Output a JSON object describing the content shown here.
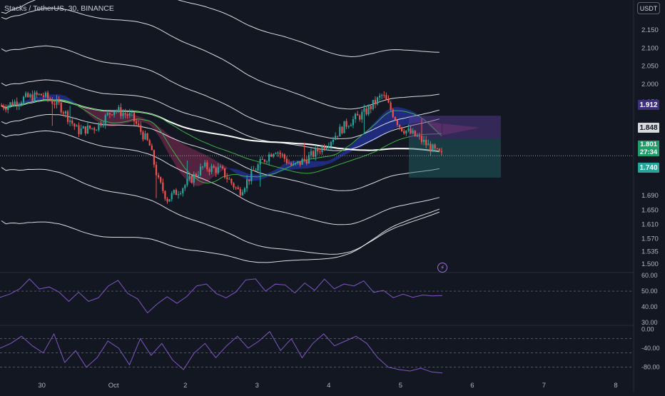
{
  "header": {
    "symbol_title": "Stacks / TetherUS, 30, BINANCE",
    "currency_button": "USDT"
  },
  "price_badges": {
    "upper": "1.912",
    "mid": "1.848",
    "current": "1.801",
    "countdown": "27:34",
    "lower": "1.740"
  },
  "icons": {
    "flash": "lightning-icon"
  },
  "colors": {
    "background": "#131722",
    "bull": "#26a69a",
    "bear": "#ef5350",
    "band": "#ffffff",
    "ma": "#3cb043",
    "oscillator": "#7e57c2",
    "cloud_bull": "#2a3cc8",
    "cloud_bear": "#8a2d5a"
  },
  "chart_data": [
    {
      "type": "candlestick",
      "symbol": "Stacks / TetherUS",
      "interval": "30",
      "exchange": "BINANCE",
      "x_ticks": [
        "30",
        "Oct",
        "2",
        "3",
        "4",
        "5",
        "6",
        "7",
        "8"
      ],
      "y_ticks": [
        2.15,
        2.1,
        2.05,
        2.0,
        1.95,
        1.912,
        1.848,
        1.801,
        1.74,
        1.69,
        1.65,
        1.61,
        1.57,
        1.535,
        1.5
      ],
      "ylim": [
        1.48,
        2.19
      ],
      "close_path": [
        [
          "09-29 12:00",
          1.94
        ],
        [
          "09-29 18:00",
          1.96
        ],
        [
          "09-30 00:00",
          1.97
        ],
        [
          "09-30 06:00",
          1.94
        ],
        [
          "09-30 12:00",
          1.87
        ],
        [
          "09-30 18:00",
          1.88
        ],
        [
          "10-01 00:00",
          1.93
        ],
        [
          "10-01 06:00",
          1.91
        ],
        [
          "10-01 12:00",
          1.83
        ],
        [
          "10-01 15:00",
          1.73
        ],
        [
          "10-01 18:00",
          1.68
        ],
        [
          "10-02 00:00",
          1.72
        ],
        [
          "10-02 06:00",
          1.77
        ],
        [
          "10-02 12:00",
          1.76
        ],
        [
          "10-02 18:00",
          1.7
        ],
        [
          "10-03 00:00",
          1.77
        ],
        [
          "10-03 06:00",
          1.82
        ],
        [
          "10-03 12:00",
          1.77
        ],
        [
          "10-03 18:00",
          1.8
        ],
        [
          "10-04 00:00",
          1.84
        ],
        [
          "10-04 06:00",
          1.89
        ],
        [
          "10-04 12:00",
          1.92
        ],
        [
          "10-04 18:00",
          1.97
        ],
        [
          "10-05 00:00",
          1.88
        ],
        [
          "10-05 06:00",
          1.85
        ],
        [
          "10-05 12:00",
          1.81
        ],
        [
          "10-05 14:00",
          1.8
        ]
      ],
      "position_tool": {
        "entry": 1.848,
        "stop": 1.912,
        "target": 1.74
      },
      "last_price": 1.801,
      "countdown": "27:34"
    },
    {
      "type": "line",
      "title": "",
      "y_ticks": [
        60.0,
        50.0,
        40.0,
        30.0
      ],
      "ylim": [
        29,
        61
      ],
      "levels": [
        50
      ],
      "series": [
        {
          "values": [
            46,
            47,
            53,
            57,
            51,
            54,
            48,
            44,
            50,
            42,
            47,
            53,
            56,
            50,
            44,
            36,
            43,
            45,
            43,
            47,
            52,
            56,
            48,
            45,
            51,
            56,
            58,
            51,
            53,
            55,
            49,
            54,
            52,
            57,
            51,
            56,
            52,
            57,
            50,
            49,
            47,
            48,
            45,
            49,
            46,
            47
          ]
        }
      ]
    },
    {
      "type": "line",
      "title": "",
      "y_ticks": [
        0.0,
        -40.0,
        -80.0
      ],
      "ylim": [
        -100,
        5
      ],
      "levels": [
        -20,
        -50,
        -80
      ],
      "series": [
        {
          "values": [
            -40,
            -30,
            -15,
            -35,
            -50,
            -10,
            -70,
            -45,
            -80,
            -60,
            -25,
            -40,
            -75,
            -20,
            -55,
            -30,
            -65,
            -85,
            -50,
            -30,
            -60,
            -35,
            -15,
            -40,
            -25,
            -5,
            -45,
            -20,
            -60,
            -30,
            -10,
            -35,
            -25,
            -15,
            -30,
            -60,
            -80,
            -85,
            -88,
            -82,
            -90,
            -92
          ]
        }
      ]
    }
  ]
}
